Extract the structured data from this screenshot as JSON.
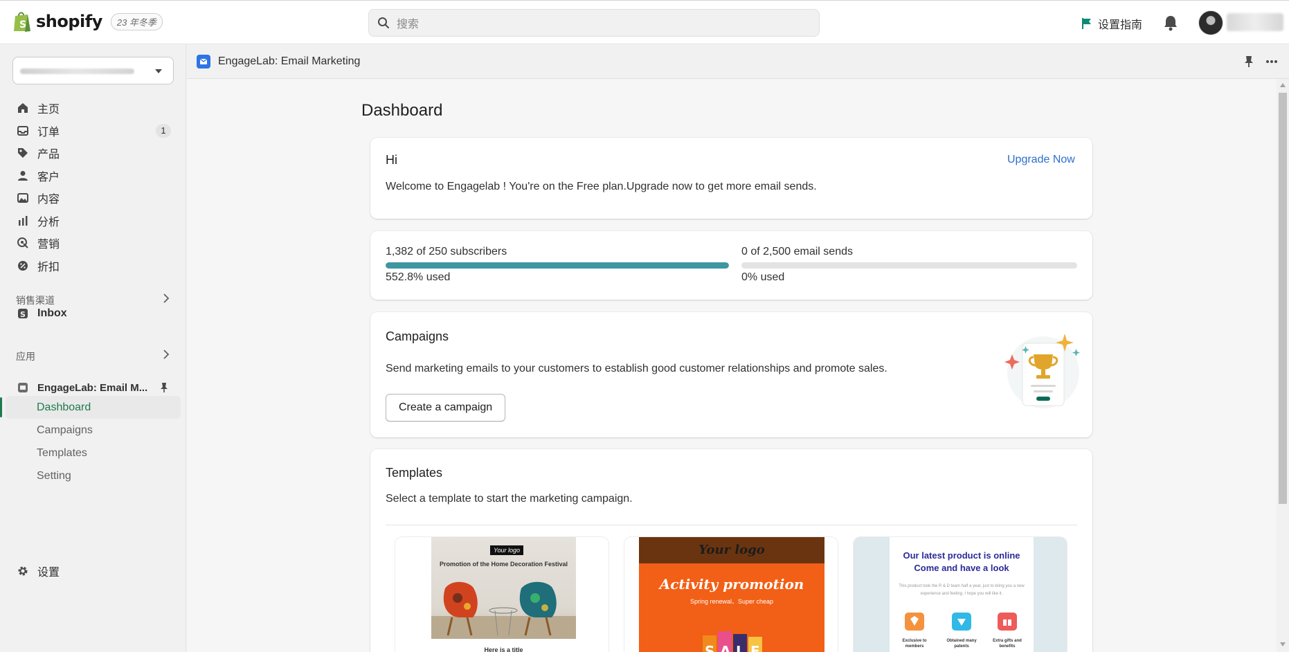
{
  "topbar": {
    "brand": "shopify",
    "edition": "23 年冬季",
    "search_placeholder": "搜索",
    "setup_guide": "设置指南"
  },
  "sidebar": {
    "nav": [
      {
        "label": "主页",
        "icon": "home-icon"
      },
      {
        "label": "订单",
        "icon": "inbox-icon",
        "badge": "1"
      },
      {
        "label": "产品",
        "icon": "tag-icon"
      },
      {
        "label": "客户",
        "icon": "person-icon"
      },
      {
        "label": "内容",
        "icon": "image-icon"
      },
      {
        "label": "分析",
        "icon": "bar-chart-icon"
      },
      {
        "label": "营销",
        "icon": "target-icon"
      },
      {
        "label": "折扣",
        "icon": "discount-icon"
      }
    ],
    "sales_channels_heading": "销售渠道",
    "inbox_label": "Inbox",
    "apps_heading": "应用",
    "app_name": "EngageLab: Email M...",
    "app_sub_items": [
      "Dashboard",
      "Campaigns",
      "Templates",
      "Setting"
    ],
    "active_sub_item": "Dashboard",
    "settings_label": "设置"
  },
  "app_header": {
    "title": "EngageLab: Email Marketing"
  },
  "main": {
    "page_title": "Dashboard",
    "hi_card": {
      "heading": "Hi",
      "upgrade_link": "Upgrade Now",
      "message": "Welcome to Engagelab ! You're on the Free plan.Upgrade now to get more email sends."
    },
    "usage": {
      "subscribers_text": "1,382 of 250 subscribers",
      "subscribers_used_text": "552.8% used",
      "subscribers_fill_fraction": 1.0,
      "sends_text": "0 of 2,500 email sends",
      "sends_used_text": "0% used",
      "sends_fill_fraction": 0.0
    },
    "campaigns_card": {
      "heading": "Campaigns",
      "description": "Send marketing emails to your customers to establish good customer relationships and promote sales.",
      "button": "Create a campaign"
    },
    "templates_card": {
      "heading": "Templates",
      "description": "Select a template to start the marketing campaign.",
      "template1": {
        "logo": "Your logo",
        "headline": "Promotion of the Home Decoration Festival",
        "title": "Here is a title"
      },
      "template2": {
        "logo": "Your logo",
        "headline": "Activity promotion",
        "subline": "Spring renewal、Super cheap",
        "sale": "SALE"
      },
      "template3": {
        "headline_line1": "Our latest product is online",
        "headline_line2": "Come and have a look",
        "description": "This product took the R & D team half a year, just to bring you a new experience and feeling. I hope you will like it.",
        "features": [
          "Exclusive to members",
          "Obtained many patents",
          "Extra gifts and benefits"
        ]
      }
    }
  },
  "colors": {
    "accent_green": "#1e7a4f",
    "link_blue": "#2c6ecb",
    "progress_teal": "#3d96a0"
  }
}
